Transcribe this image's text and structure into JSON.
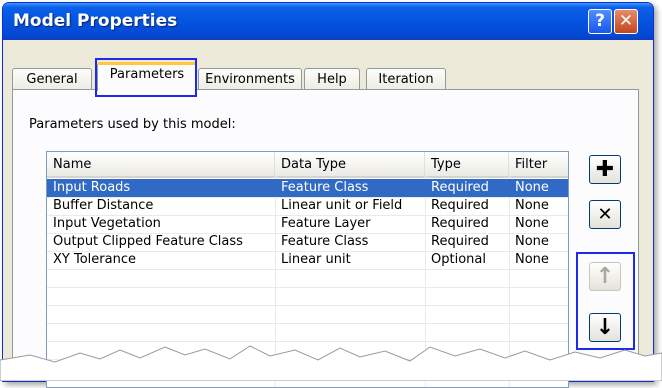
{
  "window": {
    "title": "Model Properties"
  },
  "title_buttons": {
    "help": "?",
    "close": "✕"
  },
  "tabs": [
    {
      "label": "General"
    },
    {
      "label": "Parameters"
    },
    {
      "label": "Environments"
    },
    {
      "label": "Help"
    },
    {
      "label": "Iteration"
    }
  ],
  "caption": "Parameters used by this model:",
  "table": {
    "columns": [
      "Name",
      "Data Type",
      "Type",
      "Filter"
    ],
    "rows": [
      [
        "Input Roads",
        "Feature Class",
        "Required",
        "None"
      ],
      [
        "Buffer Distance",
        "Linear unit or Field",
        "Required",
        "None"
      ],
      [
        "Input Vegetation",
        "Feature Layer",
        "Required",
        "None"
      ],
      [
        "Output Clipped Feature Class",
        "Feature Class",
        "Required",
        "None"
      ],
      [
        "XY Tolerance",
        "Linear unit",
        "Optional",
        "None"
      ]
    ],
    "selected_row": 0
  },
  "side_buttons": {
    "add": "plus-icon",
    "remove": "x-icon",
    "move_up": "arrow-up-icon",
    "move_down": "arrow-down-icon"
  },
  "colors": {
    "titlebar": "#0454e0",
    "selection": "#316ac5",
    "highlight_box": "#1d2ae8"
  }
}
